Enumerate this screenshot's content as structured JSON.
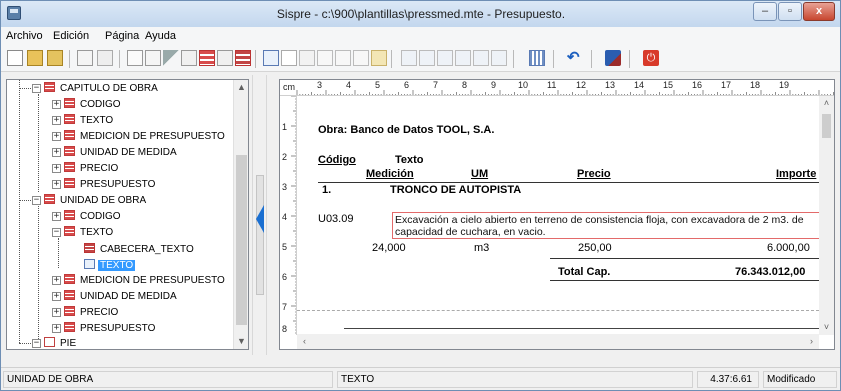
{
  "window": {
    "title": "Sispre - c:\\900\\plantillas\\pressmed.mte - Presupuesto.",
    "minimize_glyph": "‒",
    "maximize_glyph": "▫",
    "close_glyph": "x"
  },
  "menu": [
    "Archivo",
    "Edición",
    "Página",
    "Ayuda"
  ],
  "tree": {
    "nodes": [
      {
        "label": "CAPITULO DE OBRA",
        "icon": "table-icon"
      },
      {
        "label": "CODIGO",
        "icon": "table-icon"
      },
      {
        "label": "TEXTO",
        "icon": "table-icon"
      },
      {
        "label": "MEDICION DE PRESUPUESTO",
        "icon": "table-icon"
      },
      {
        "label": "UNIDAD DE MEDIDA",
        "icon": "table-icon"
      },
      {
        "label": "PRECIO",
        "icon": "table-icon"
      },
      {
        "label": "PRESUPUESTO",
        "icon": "table-icon"
      },
      {
        "label": "UNIDAD DE OBRA",
        "icon": "table-icon"
      },
      {
        "label": "CODIGO",
        "icon": "table-icon"
      },
      {
        "label": "TEXTO",
        "icon": "table-icon"
      },
      {
        "label": "CABECERA_TEXTO",
        "icon": "header-icon"
      },
      {
        "label": "TEXTO",
        "icon": "text-field-icon",
        "selected": true
      },
      {
        "label": "MEDICION DE PRESUPUESTO",
        "icon": "table-icon"
      },
      {
        "label": "UNIDAD DE MEDIDA",
        "icon": "table-icon"
      },
      {
        "label": "PRECIO",
        "icon": "table-icon"
      },
      {
        "label": "PRESUPUESTO",
        "icon": "table-icon"
      },
      {
        "label": "PIE",
        "icon": "page-icon"
      }
    ]
  },
  "ruler": {
    "unit": "cm",
    "h_numbers": [
      "3",
      "4",
      "5",
      "6",
      "7",
      "8",
      "9",
      "10",
      "11",
      "12",
      "13",
      "14",
      "15",
      "16",
      "17",
      "18",
      "19"
    ],
    "v_numbers": [
      "1",
      "2",
      "3",
      "4",
      "5",
      "6",
      "7",
      "8"
    ]
  },
  "document": {
    "obra": "Obra: Banco de Datos TOOL, S.A.",
    "headers": {
      "codigo": "Código",
      "texto": "Texto",
      "medicion": "Medición",
      "um": "UM",
      "precio": "Precio",
      "importe": "Importe"
    },
    "chapter_number": "1.",
    "chapter_title": "TRONCO DE AUTOPISTA",
    "item_code": "U03.09",
    "item_description": "Excavación a cielo abierto en terreno de consistencia floja, con excavadora de 2 m3. de capacidad de cuchara, en vacio.",
    "medicion": "24,000",
    "um": "m3",
    "precio": "250,00",
    "importe": "6.000,00",
    "total_label": "Total Cap.",
    "total_value": "76.343.012,00"
  },
  "status": {
    "section": "UNIDAD DE OBRA",
    "field": "TEXTO",
    "position": "4.37:6.61",
    "state": "Modificado"
  },
  "colors": {
    "selection": "#3399ff",
    "field_box": "#e36a6a",
    "splitter_arrow": "#1a6fd1"
  }
}
